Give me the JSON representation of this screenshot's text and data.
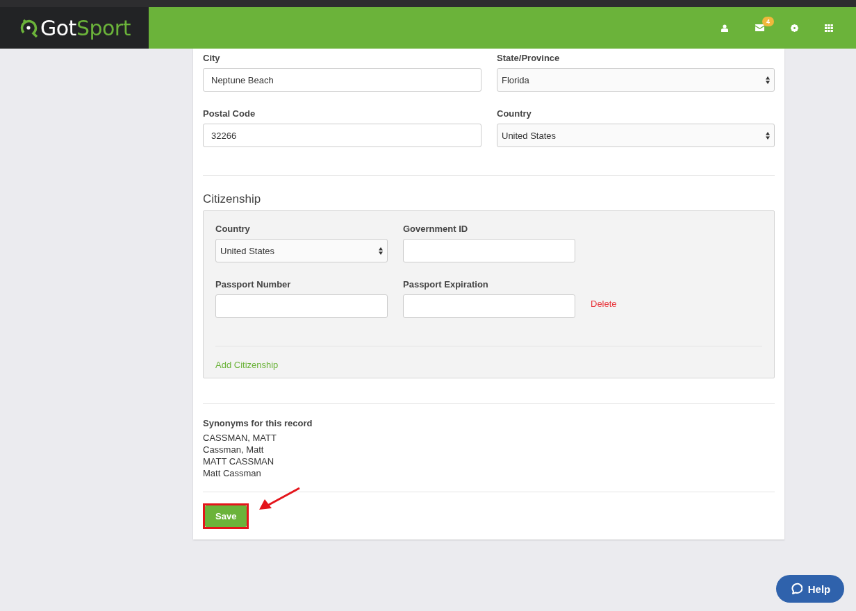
{
  "header": {
    "logo": {
      "first": "Got",
      "second": "Sport"
    },
    "mail_badge": "4"
  },
  "address": {
    "fields": [
      {
        "label": "City",
        "kind": "text",
        "value": "Neptune Beach"
      },
      {
        "label": "State/Province",
        "kind": "select",
        "value": "Florida"
      },
      {
        "label": "Postal Code",
        "kind": "text",
        "value": "32266"
      },
      {
        "label": "Country",
        "kind": "select",
        "value": "United States"
      }
    ]
  },
  "citizenship": {
    "title": "Citizenship",
    "fields": [
      {
        "label": "Country",
        "kind": "select",
        "value": "United States"
      },
      {
        "label": "Government ID",
        "kind": "text"
      },
      {
        "label": "Passport Number",
        "kind": "text"
      },
      {
        "label": "Passport Expiration",
        "kind": "text"
      }
    ],
    "delete_link": "Delete",
    "add_link": "Add Citizenship"
  },
  "synonyms": {
    "title": "Synonyms for this record",
    "names": [
      "CASSMAN, MATT",
      "Cassman, Matt",
      "MATT CASSMAN",
      "Matt Cassman"
    ]
  },
  "save_button": "Save",
  "help_button": "Help"
}
